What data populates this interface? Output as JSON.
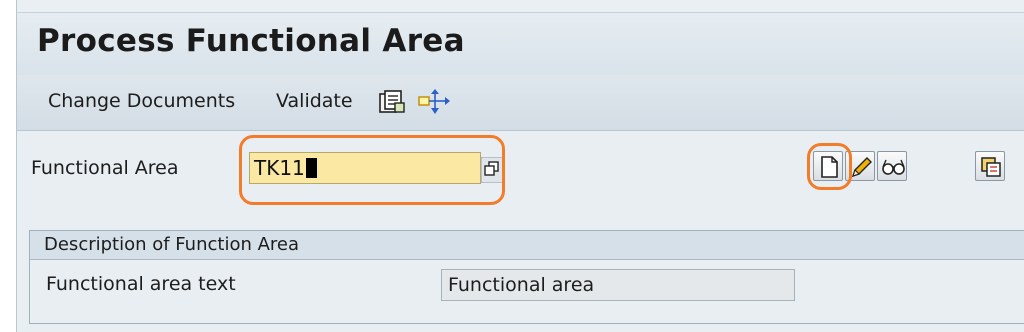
{
  "title": "Process Functional Area",
  "toolbar": {
    "change_documents": "Change Documents",
    "validate": "Validate"
  },
  "functional_area": {
    "label": "Functional Area",
    "value": "TK11"
  },
  "group": {
    "title": "Description of Function Area",
    "text_label": "Functional area text",
    "text_value": "Functional area"
  },
  "icons": [
    "other-object-icon",
    "hierarchy-icon",
    "value-help-icon",
    "create-icon",
    "change-icon",
    "display-icon",
    "copy-icon"
  ],
  "colors": {
    "input_highlight": "#fbe9a3",
    "annotation": "#f27c2a"
  }
}
